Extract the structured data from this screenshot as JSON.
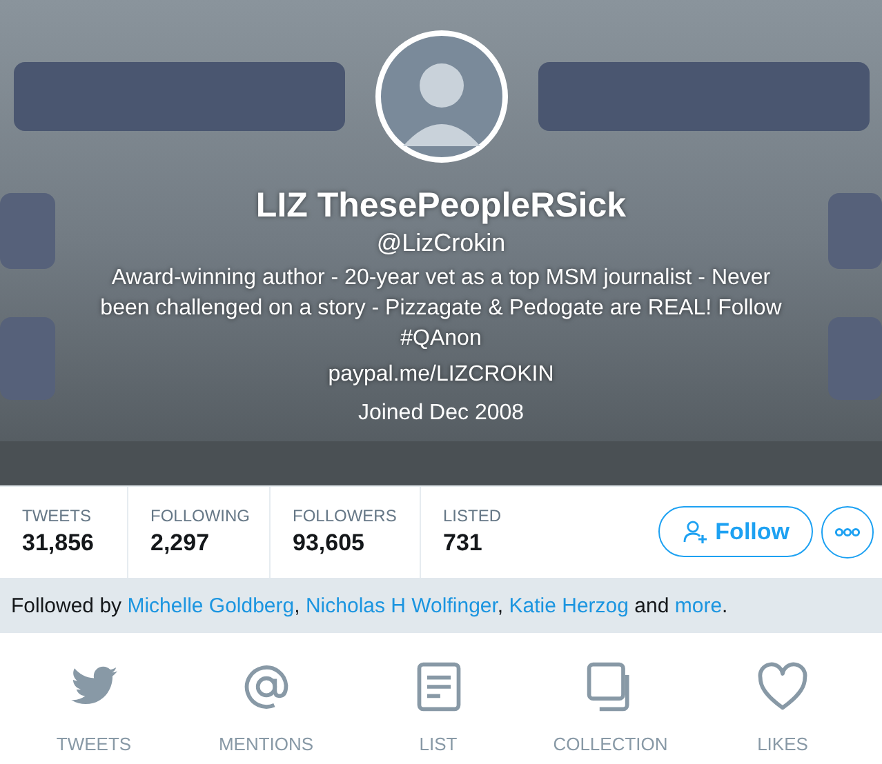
{
  "profile": {
    "kind": "picture",
    "name": "LIZ ThesePeopleRSick",
    "handle": "@LizCrokin",
    "bio": "Award-winning author - 20-year vet as a top MSM journalist - Never been challenged on a story - Pizzagate & Pedogate are REAL! Follow #QAnon",
    "website": "paypal.me/LIZCROKIN",
    "joined": "Joined Dec 2008"
  },
  "stats": [
    {
      "label": "TWEETS",
      "value": "31,856"
    },
    {
      "label": "FOLLOWING",
      "value": "2,297"
    },
    {
      "label": "FOLLOWERS",
      "value": "93,605"
    },
    {
      "label": "LISTED",
      "value": "731"
    }
  ],
  "follow_button": {
    "label": "Follow"
  },
  "followed_by": [
    {
      "kind": "text",
      "text": "Followed by "
    },
    {
      "kind": "link",
      "text": "Michelle Goldberg"
    },
    {
      "kind": "text",
      "text": ", "
    },
    {
      "kind": "link",
      "text": "Nicholas H Wolfinger"
    },
    {
      "kind": "text",
      "text": ", "
    },
    {
      "kind": "link",
      "text": "Katie Herzog"
    },
    {
      "kind": "text",
      "text": " and "
    },
    {
      "kind": "link",
      "text": "more"
    },
    {
      "kind": "text",
      "text": "."
    }
  ],
  "tabs": [
    {
      "label": "TWEETS"
    },
    {
      "label": "MENTIONS"
    },
    {
      "label": "LIST"
    },
    {
      "label": "COLLECTION"
    },
    {
      "label": "LIKES"
    }
  ]
}
